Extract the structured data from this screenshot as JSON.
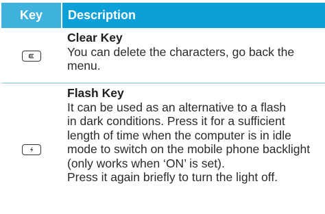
{
  "table": {
    "header": {
      "key": "Key",
      "description": "Description"
    },
    "rows": [
      {
        "icon": "clear-key-icon",
        "title": "Clear Key",
        "lines": [
          "You can delete the characters, go back the",
          "menu."
        ]
      },
      {
        "icon": "flash-key-icon",
        "title": "Flash Key",
        "lines": [
          "It can be used as an alternative to a flash",
          "in dark conditions. Press it for a sufficient",
          "length of time when the computer is in idle",
          "mode to switch on the mobile phone backlight",
          "(only works when ‘ON’ is set).",
          "Press it again briefly to turn the light off."
        ]
      }
    ]
  },
  "colors": {
    "header_key_bg": "#3eb1dc",
    "header_desc_bg": "#0d9fd8",
    "row_divider": "#7ecde9"
  }
}
